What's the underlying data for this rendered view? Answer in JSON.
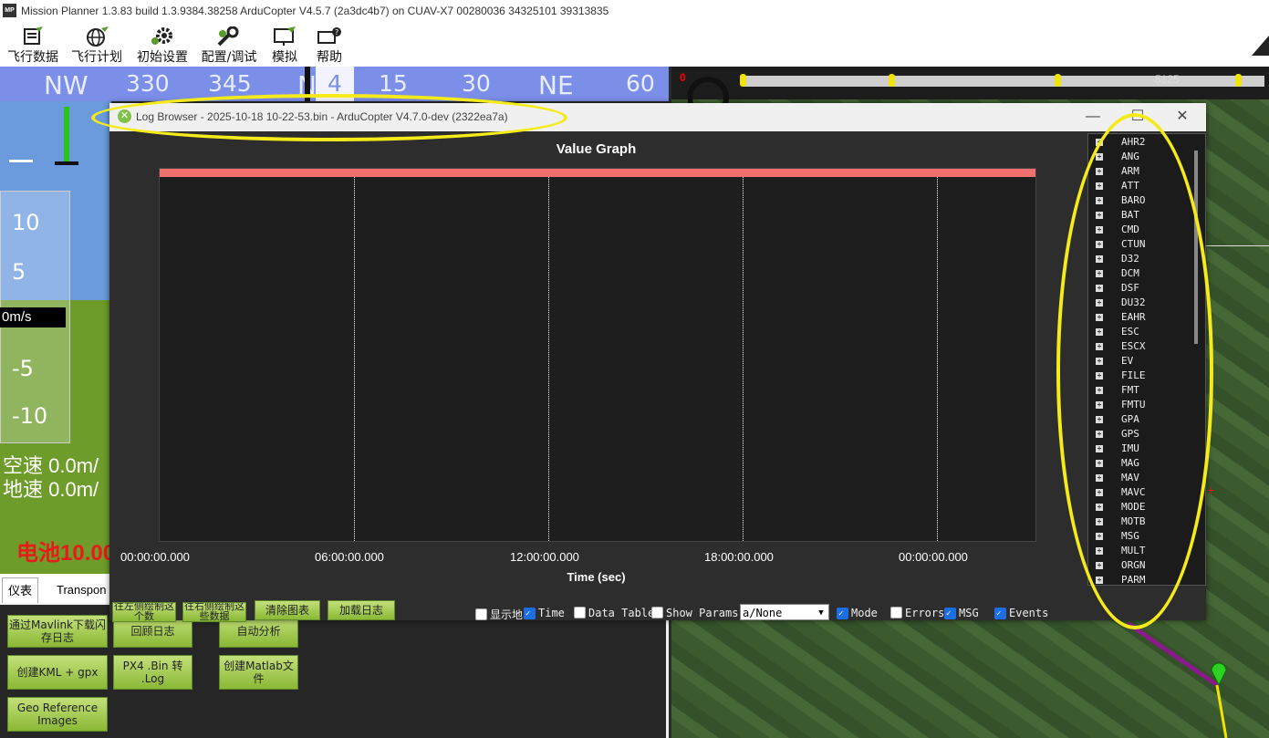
{
  "app": {
    "title": "Mission Planner 1.3.83 build 1.3.9384.38258 ArduCopter V4.5.7 (2a3dc4b7) on CUAV-X7 00280036 34325101 39313835",
    "logo": "MP"
  },
  "toolbar": {
    "items": [
      {
        "label": "飞行数据",
        "icon": "flight-data-icon"
      },
      {
        "label": "飞行计划",
        "icon": "globe-icon"
      },
      {
        "label": "初始设置",
        "icon": "gear-icon"
      },
      {
        "label": "配置/调试",
        "icon": "wrench-icon"
      },
      {
        "label": "模拟",
        "icon": "simulation-icon"
      },
      {
        "label": "帮助",
        "icon": "help-icon"
      }
    ]
  },
  "compass": {
    "labels": [
      "NW",
      "330",
      "345",
      "N",
      "4",
      "15",
      "30",
      "NE",
      "60"
    ]
  },
  "hud": {
    "tape": [
      "10",
      "5",
      "-5",
      "-10"
    ],
    "speed": "0m/s",
    "airspeed": "空速 0.0m/",
    "groundspeed": "地速 0.0m/",
    "battery": "电池10.00"
  },
  "tabs": [
    "仪表",
    "Transpon"
  ],
  "bottom_panel": {
    "buttons": [
      {
        "label": "往左侧绘制这个数",
        "name": "plot-left-button"
      },
      {
        "label": "往右侧绘制这些数据",
        "name": "plot-right-button"
      },
      {
        "label": "清除图表",
        "name": "clear-graph-button"
      },
      {
        "label": "加载日志",
        "name": "load-log-button"
      },
      {
        "label": "通过Mavlink下载闪存日志",
        "name": "download-mavlink-button"
      },
      {
        "label": "回顾日志",
        "name": "review-log-button"
      },
      {
        "label": "自动分析",
        "name": "auto-analysis-button"
      },
      {
        "label": "创建KML + gpx",
        "name": "create-kml-button"
      },
      {
        "label": "PX4 .Bin 转 .Log",
        "name": "px4-bin-log-button"
      },
      {
        "label": "创建Matlab文件",
        "name": "create-matlab-button"
      },
      {
        "label": "Geo Reference Images",
        "name": "geo-reference-button"
      }
    ]
  },
  "map": {
    "slider_value": "5125",
    "zero_label": "0"
  },
  "log_browser": {
    "title": "Log Browser - 2025-10-18 10-22-53.bin - ArduCopter V4.7.0-dev (2322ea7a)",
    "graph_title": "Value Graph",
    "x_label": "Time (sec)",
    "x_ticks": [
      "00:00:00.000",
      "06:00:00.000",
      "12:00:00.000",
      "18:00:00.000",
      "00:00:00.000"
    ],
    "tree_items": [
      "AHR2",
      "ANG",
      "ARM",
      "ATT",
      "BARO",
      "BAT",
      "CMD",
      "CTUN",
      "D32",
      "DCM",
      "DSF",
      "DU32",
      "EAHR",
      "ESC",
      "ESCX",
      "EV",
      "FILE",
      "FMT",
      "FMTU",
      "GPA",
      "GPS",
      "IMU",
      "MAG",
      "MAV",
      "MAVC",
      "MODE",
      "MOTB",
      "MSG",
      "MULT",
      "ORGN",
      "PARM"
    ],
    "checkboxes": [
      {
        "label": "显示地",
        "checked": false
      },
      {
        "label": "Time",
        "checked": true
      },
      {
        "label": "Data Table",
        "checked": false
      },
      {
        "label": "Show Params",
        "checked": false
      },
      {
        "label": "Mode",
        "checked": true
      },
      {
        "label": "Errors",
        "checked": false
      },
      {
        "label": "MSG",
        "checked": true
      },
      {
        "label": "Events",
        "checked": true
      }
    ],
    "dropdown_value": "a/None"
  },
  "colors": {
    "highlight": "#f5ea1a",
    "compass": "#7c8fe8",
    "button_green": "#a6cf55",
    "plot_band": "#f07070"
  }
}
